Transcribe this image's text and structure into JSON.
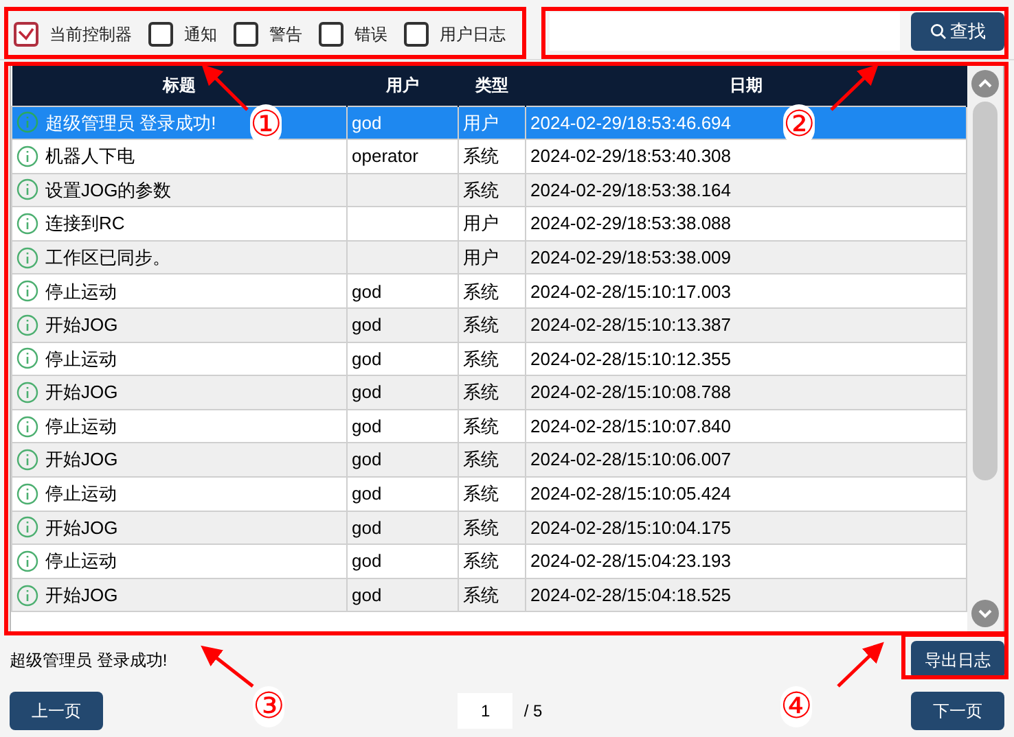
{
  "filters": [
    {
      "label": "当前控制器",
      "checked": true
    },
    {
      "label": "通知",
      "checked": false
    },
    {
      "label": "警告",
      "checked": false
    },
    {
      "label": "错误",
      "checked": false
    },
    {
      "label": "用户日志",
      "checked": false
    }
  ],
  "search": {
    "button": "查找"
  },
  "table": {
    "columns": [
      "标题",
      "用户",
      "类型",
      "日期"
    ],
    "rows": [
      {
        "title": "超级管理员 登录成功!",
        "user": "god",
        "type": "用户",
        "date": "2024-02-29/18:53:46.694",
        "selected": true
      },
      {
        "title": "机器人下电",
        "user": "operator",
        "type": "系统",
        "date": "2024-02-29/18:53:40.308",
        "selected": false
      },
      {
        "title": "设置JOG的参数",
        "user": "",
        "type": "系统",
        "date": "2024-02-29/18:53:38.164",
        "selected": false
      },
      {
        "title": "连接到RC",
        "user": "",
        "type": "用户",
        "date": "2024-02-29/18:53:38.088",
        "selected": false
      },
      {
        "title": "工作区已同步。",
        "user": "",
        "type": "用户",
        "date": "2024-02-29/18:53:38.009",
        "selected": false
      },
      {
        "title": "停止运动",
        "user": "god",
        "type": "系统",
        "date": "2024-02-28/15:10:17.003",
        "selected": false
      },
      {
        "title": "开始JOG",
        "user": "god",
        "type": "系统",
        "date": "2024-02-28/15:10:13.387",
        "selected": false
      },
      {
        "title": "停止运动",
        "user": "god",
        "type": "系统",
        "date": "2024-02-28/15:10:12.355",
        "selected": false
      },
      {
        "title": "开始JOG",
        "user": "god",
        "type": "系统",
        "date": "2024-02-28/15:10:08.788",
        "selected": false
      },
      {
        "title": "停止运动",
        "user": "god",
        "type": "系统",
        "date": "2024-02-28/15:10:07.840",
        "selected": false
      },
      {
        "title": "开始JOG",
        "user": "god",
        "type": "系统",
        "date": "2024-02-28/15:10:06.007",
        "selected": false
      },
      {
        "title": "停止运动",
        "user": "god",
        "type": "系统",
        "date": "2024-02-28/15:10:05.424",
        "selected": false
      },
      {
        "title": "开始JOG",
        "user": "god",
        "type": "系统",
        "date": "2024-02-28/15:10:04.175",
        "selected": false
      },
      {
        "title": "停止运动",
        "user": "god",
        "type": "系统",
        "date": "2024-02-28/15:04:23.193",
        "selected": false
      },
      {
        "title": "开始JOG",
        "user": "god",
        "type": "系统",
        "date": "2024-02-28/15:04:18.525",
        "selected": false
      }
    ]
  },
  "status_message": "超级管理员 登录成功!",
  "export_button": "导出日志",
  "pagination": {
    "previous": "上一页",
    "page": "1",
    "total": "/ 5",
    "next": "下一页"
  },
  "annotations": [
    "①",
    "②",
    "③",
    "④"
  ]
}
